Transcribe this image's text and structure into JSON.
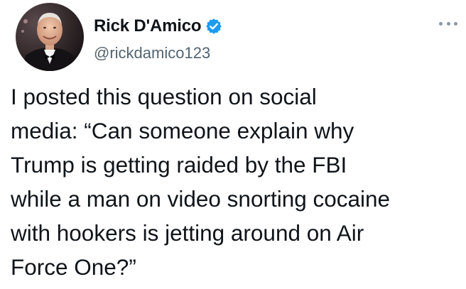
{
  "tweet": {
    "author": {
      "display_name": "Rick D'Amico",
      "handle": "@rickdamico123",
      "verified": true,
      "avatar_icon": "profile-photo"
    },
    "more_icon": "more-options-icon",
    "text_lines": [
      "I posted this question on social",
      "media: “Can someone explain why",
      "Trump is getting raided by the FBI",
      "while a man on video snorting cocaine",
      "with hookers is jetting around on Air",
      "Force One?”"
    ]
  },
  "colors": {
    "text": "#0f1419",
    "secondary_text": "#536471",
    "verified_badge": "#1d9bf0",
    "background": "#ffffff"
  }
}
